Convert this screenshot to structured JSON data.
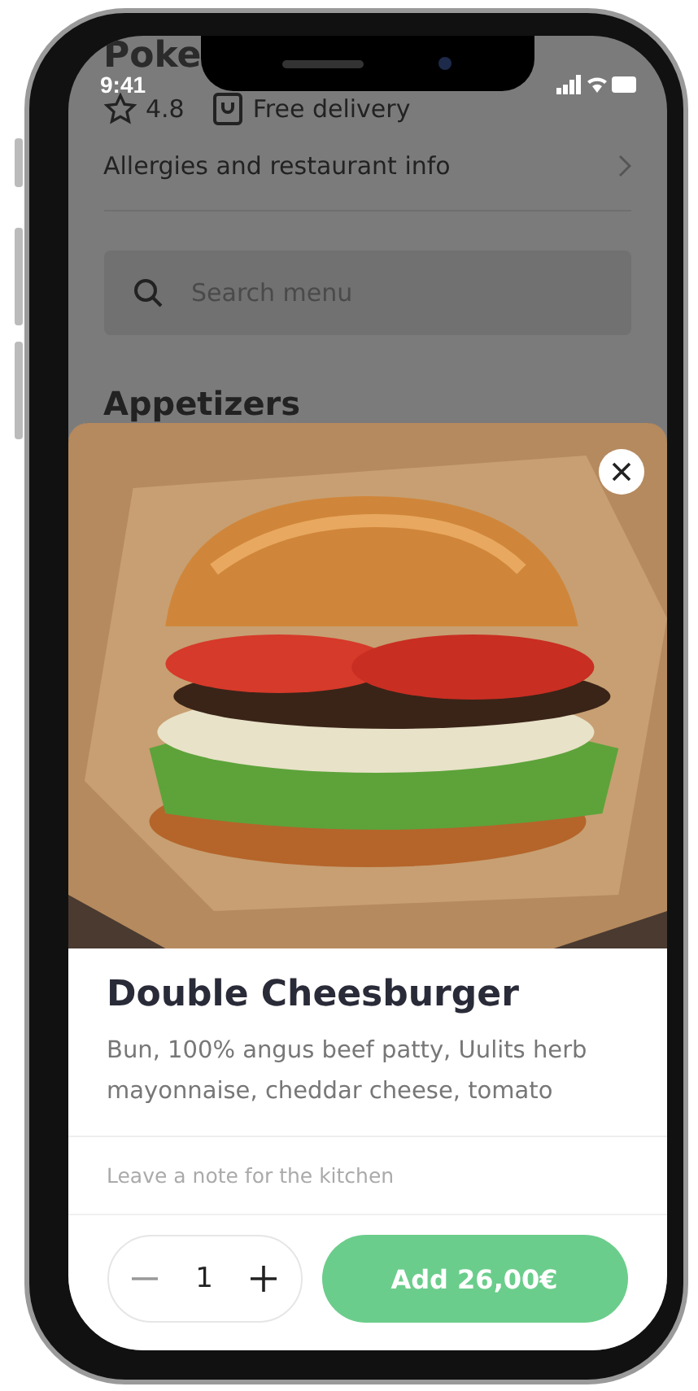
{
  "status_bar": {
    "time": "9:41"
  },
  "restaurant": {
    "name": "Poke",
    "rating": "4.8",
    "delivery": "Free delivery",
    "info_link": "Allergies and restaurant info"
  },
  "search": {
    "placeholder": "Search menu"
  },
  "section_title": "Appetizers",
  "item": {
    "name": "Double Cheesburger",
    "description": "Bun, 100% angus beef patty, Uulits herb mayonnaise, cheddar cheese, tomato",
    "note": {
      "placeholder": "Leave a note for the kitchen"
    },
    "quantity": "1",
    "add_button": "Add 26,00€"
  }
}
